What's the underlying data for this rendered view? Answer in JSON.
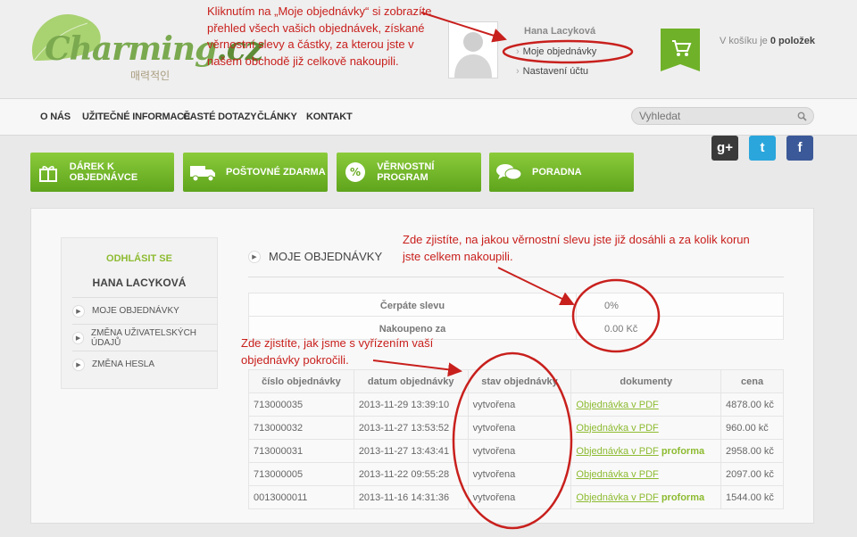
{
  "logo": {
    "name": "Charming",
    "tld": ".cz",
    "tagline": "매력적인"
  },
  "annotations": {
    "top": "Kliknutím na „Moje objednávky“ si zobrazíte přehled všech vašich objednávek, získané věrnostní slevy a částky, za kterou jste v našem obchodě již celkově nakoupili.",
    "summary": "Zde zjistíte, na jakou věrnostní slevu jste již dosáhli a za kolik korun jste celkem nakoupili.",
    "status": "Zde zjistíte, jak jsme s vyřízením vaší objednávky pokročili."
  },
  "user": {
    "name": "Hana Lacyková",
    "links": [
      "Moje objednávky",
      "Nastavení účtu"
    ]
  },
  "cart": {
    "prefix": "V košíku je",
    "count": "0 položek"
  },
  "nav": {
    "items": [
      "O NÁS",
      "UŽITEČNÉ INFORMACE",
      "ČASTÉ DOTAZY",
      "ČLÁNKY",
      "KONTAKT"
    ],
    "search_placeholder": "Vyhledat"
  },
  "social": {
    "google": "g+",
    "twitter": "t",
    "facebook": "f"
  },
  "promos": [
    "DÁREK K OBJEDNÁVCE",
    "POŠTOVNÉ ZDARMA",
    "VĚRNOSTNÍ PROGRAM",
    "PORADNA"
  ],
  "sidebar": {
    "logout": "ODHLÁSIT SE",
    "user": "HANA LACYKOVÁ",
    "items": [
      "MOJE OBJEDNÁVKY",
      "ZMĚNA UŽIVATELSKÝCH ÚDAJŮ",
      "ZMĚNA HESLA"
    ]
  },
  "main": {
    "title": "MOJE OBJEDNÁVKY",
    "discount_label": "Čerpáte slevu",
    "discount_value": "0%",
    "total_label": "Nakoupeno za",
    "total_value": "0.00 Kč"
  },
  "orders": {
    "headers": [
      "číslo objednávky",
      "datum objednávky",
      "stav objednávky",
      "dokumenty",
      "cena"
    ],
    "rows": [
      {
        "id": "713000035",
        "date": "2013-11-29 13:39:10",
        "status": "vytvořena",
        "doc": "Objednávka v PDF",
        "extra": "",
        "price": "4878.00 kč"
      },
      {
        "id": "713000032",
        "date": "2013-11-27 13:53:52",
        "status": "vytvořena",
        "doc": "Objednávka v PDF",
        "extra": "",
        "price": "960.00 kč"
      },
      {
        "id": "713000031",
        "date": "2013-11-27 13:43:41",
        "status": "vytvořena",
        "doc": "Objednávka v PDF",
        "extra": "proforma",
        "price": "2958.00 kč"
      },
      {
        "id": "713000005",
        "date": "2013-11-22 09:55:28",
        "status": "vytvořena",
        "doc": "Objednávka v PDF",
        "extra": "",
        "price": "2097.00 kč"
      },
      {
        "id": "0013000011",
        "date": "2013-11-16 14:31:36",
        "status": "vytvořena",
        "doc": "Objednávka v PDF",
        "extra": "proforma",
        "price": "1544.00 kč"
      }
    ]
  },
  "colors": {
    "accent_green": "#8dbb31",
    "annotation_red": "#c8201d"
  }
}
